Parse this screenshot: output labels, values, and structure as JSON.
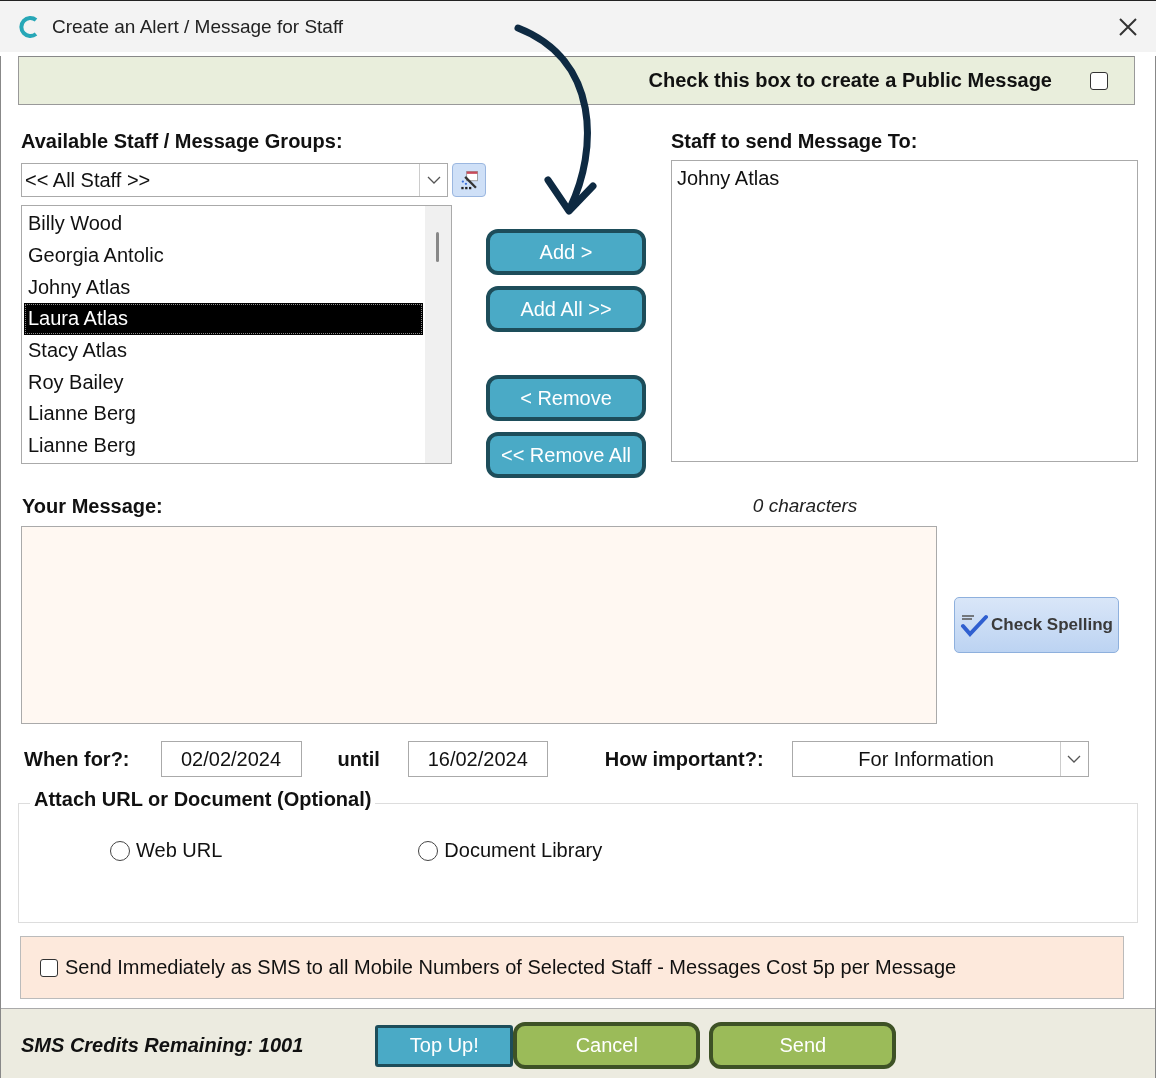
{
  "window": {
    "title": "Create an Alert / Message for Staff"
  },
  "public_message": {
    "label": "Check this box to create a Public Message",
    "checked": false
  },
  "available_staff": {
    "label": "Available Staff / Message Groups:",
    "group_dropdown": {
      "value": "<< All Staff >>"
    },
    "list": [
      {
        "name": "Billy Wood",
        "selected": false
      },
      {
        "name": "Georgia Antolic",
        "selected": false
      },
      {
        "name": "Johny Atlas",
        "selected": false
      },
      {
        "name": "Laura Atlas",
        "selected": true
      },
      {
        "name": "Stacy Atlas",
        "selected": false
      },
      {
        "name": "Roy Bailey",
        "selected": false
      },
      {
        "name": "Lianne Berg",
        "selected": false
      },
      {
        "name": "Lianne Berg",
        "selected": false
      }
    ]
  },
  "transfer_buttons": [
    {
      "label": "Add >"
    },
    {
      "label": "Add All >>"
    },
    {
      "label": "< Remove"
    },
    {
      "label": "<< Remove All"
    }
  ],
  "recipients": {
    "label": "Staff to send Message To:",
    "list": [
      "Johny Atlas"
    ]
  },
  "message": {
    "label": "Your Message:",
    "character_count": "0 characters",
    "check_spelling_button": "Check Spelling"
  },
  "schedule": {
    "when_label": "When for?:",
    "from": "02/02/2024",
    "until_label": "until",
    "until": "16/02/2024",
    "importance_label": "How important?:",
    "importance": "For Information"
  },
  "attachment": {
    "legend": "Attach URL or Document (Optional)",
    "options": [
      {
        "label": "Web URL",
        "selected": false
      },
      {
        "label": "Document Library",
        "selected": false
      }
    ]
  },
  "sms_option": {
    "label": "Send Immediately as SMS to all Mobile Numbers of Selected Staff - Messages Cost 5p per Message",
    "checked": false
  },
  "footer": {
    "credits": "SMS Credits Remaining: 1001",
    "top_up_button": "Top Up!",
    "buttons": [
      {
        "label": "Cancel"
      },
      {
        "label": "Send"
      }
    ]
  }
}
